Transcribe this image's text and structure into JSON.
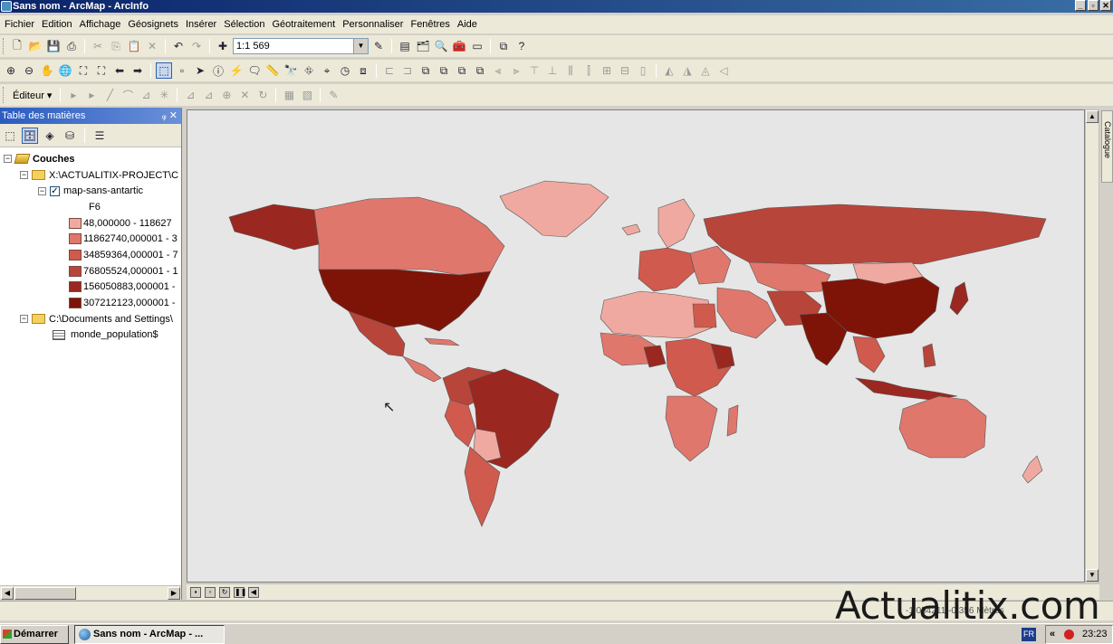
{
  "window": {
    "title": "Sans nom - ArcMap - ArcInfo"
  },
  "menu": [
    "Fichier",
    "Edition",
    "Affichage",
    "Géosignets",
    "Insérer",
    "Sélection",
    "Géotraitement",
    "Personnaliser",
    "Fenêtres",
    "Aide"
  ],
  "toolbar": {
    "scale": "1:1 569",
    "editor_label": "Éditeur ▾"
  },
  "toc": {
    "title": "Table des matières",
    "header_buttons": "ᵩ ✕",
    "root_label": "Couches",
    "folder1": "X:\\ACTUALITIX-PROJECT\\C",
    "layer_name": "map-sans-antartic",
    "field_name": "F6",
    "legend": [
      {
        "label": "48,000000 - 118627",
        "color": "#f0a9a0"
      },
      {
        "label": "11862740,000001 - 3",
        "color": "#e0776c"
      },
      {
        "label": "34859364,000001 - 7",
        "color": "#cf5a4d"
      },
      {
        "label": "76805524,000001 - 1",
        "color": "#b8453a"
      },
      {
        "label": "156050883,000001 -",
        "color": "#9a2820"
      },
      {
        "label": "307212123,000001 -",
        "color": "#7e1408"
      }
    ],
    "folder2": "C:\\Documents and Settings\\",
    "table_name": "monde_population$"
  },
  "catalog_tab": "Catalogue",
  "status": {
    "coords": "-1 054211 -0,356 Mètres"
  },
  "watermark": "Actualitix.com",
  "taskbar": {
    "start": "Démarrer",
    "task": "Sans nom - ArcMap - ...",
    "lang": "FR",
    "chevron": "«",
    "clock": "23:23"
  },
  "colors": {
    "map_bg": "#e6e6e6",
    "titlebar": "#0a246a"
  }
}
